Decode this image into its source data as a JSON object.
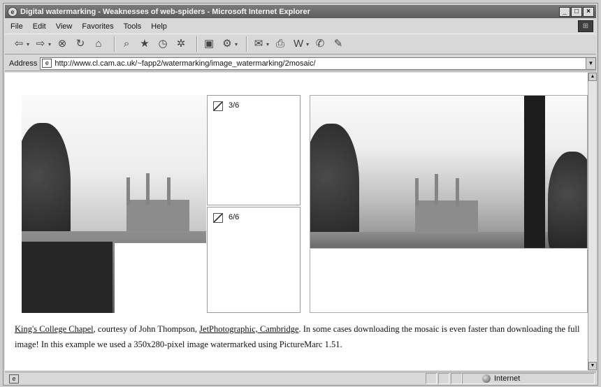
{
  "window": {
    "title": "Digital watermarking - Weaknesses of web-spiders - Microsoft Internet Explorer",
    "controls": [
      "_",
      "□",
      "×"
    ]
  },
  "menu": {
    "items": [
      {
        "label": "File",
        "key": "F"
      },
      {
        "label": "Edit",
        "key": "E"
      },
      {
        "label": "View",
        "key": "V"
      },
      {
        "label": "Favorites",
        "key": "a"
      },
      {
        "label": "Tools",
        "key": "T"
      },
      {
        "label": "Help",
        "key": "H"
      }
    ]
  },
  "toolbar": {
    "icons": [
      "back-icon",
      "forward-icon",
      "stop-icon",
      "refresh-icon",
      "home-icon",
      "search-icon",
      "favorites-icon",
      "history-icon",
      "channels-icon",
      "fullscreen-icon",
      "mail-icon",
      "print-icon",
      "edit-icon",
      "discuss-icon",
      "messenger-icon"
    ]
  },
  "address": {
    "label": "Address",
    "url": "http://www.cl.cam.ac.uk/~fapp2/watermarking/image_watermarking/2mosaic/"
  },
  "content": {
    "tiles": [
      {
        "label": "3/6"
      },
      {
        "label": "6/6"
      }
    ],
    "caption": {
      "link1": "King's College Chapel",
      "text1": ", courtesy of John Thompson, ",
      "link2": "JetPhotographic, Cambridge",
      "text2": ". In some cases downloading the mosaic is even faster than downloading the full image! In this example we used a 350x280-pixel image watermarked using PictureMarc 1.51."
    }
  },
  "status": {
    "zone": "Internet"
  }
}
